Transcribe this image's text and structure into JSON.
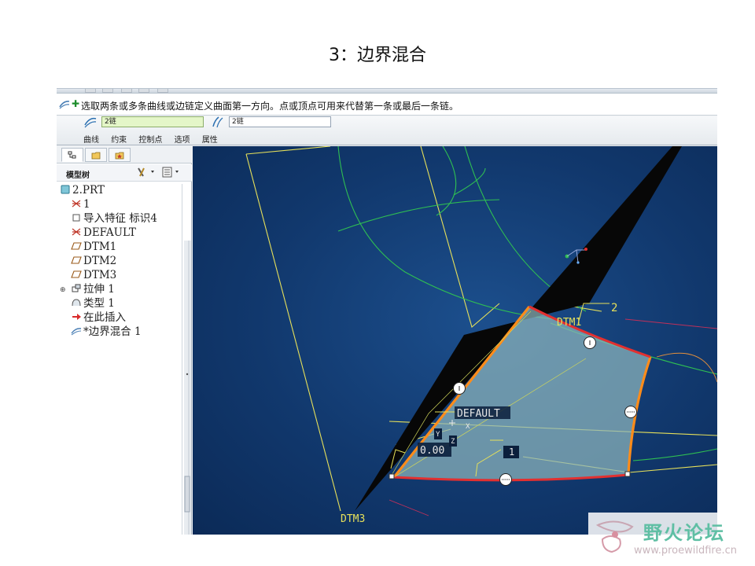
{
  "slide": {
    "title": "3：边界混合"
  },
  "prompt": {
    "message": "选取两条或多条曲线或边链定义曲面第一方向。点或顶点可用来代替第一条或最后一条链。"
  },
  "dashboard": {
    "first_dir_value": "2链",
    "second_dir_value": "2链",
    "tabs": [
      "曲线",
      "约束",
      "控制点",
      "选项",
      "属性"
    ]
  },
  "model_tree": {
    "title": "模型树",
    "items": [
      {
        "label": "2.PRT",
        "icon": "part-icon",
        "indent": 0
      },
      {
        "label": "1",
        "icon": "csys-icon",
        "indent": 1
      },
      {
        "label": "导入特征 标识4",
        "icon": "import-feature-icon",
        "indent": 1
      },
      {
        "label": "DEFAULT",
        "icon": "csys-icon",
        "indent": 1
      },
      {
        "label": "DTM1",
        "icon": "datum-plane-icon",
        "indent": 1
      },
      {
        "label": "DTM2",
        "icon": "datum-plane-icon",
        "indent": 1
      },
      {
        "label": "DTM3",
        "icon": "datum-plane-icon",
        "indent": 1
      },
      {
        "label": "拉伸 1",
        "icon": "extrude-icon",
        "indent": 1,
        "expandable": true
      },
      {
        "label": "类型 1",
        "icon": "style-icon",
        "indent": 1
      },
      {
        "label": "在此插入",
        "icon": "insert-here-icon",
        "indent": 1
      },
      {
        "label": "*边界混合 1",
        "icon": "boundary-blend-icon",
        "indent": 1
      }
    ]
  },
  "viewport": {
    "labels": {
      "dtm1": "DTM1",
      "dtm3": "DTM3",
      "default_csys": "DEFAULT",
      "axis_x": "X",
      "axis_y": "Y",
      "axis_z": "Z",
      "dim_value": "0.00",
      "chain_2": "2",
      "chain_1": "1"
    },
    "colors": {
      "background": "#11386d",
      "datum_plane": "#e6e05a",
      "curve": "#2fbf52",
      "boundary_chain": "#e23030",
      "selected_chain": "#ff8c1a",
      "surface": "#7fa8b0"
    }
  },
  "watermark": {
    "name": "野火论坛",
    "url": "www.proewildfire.cn"
  }
}
